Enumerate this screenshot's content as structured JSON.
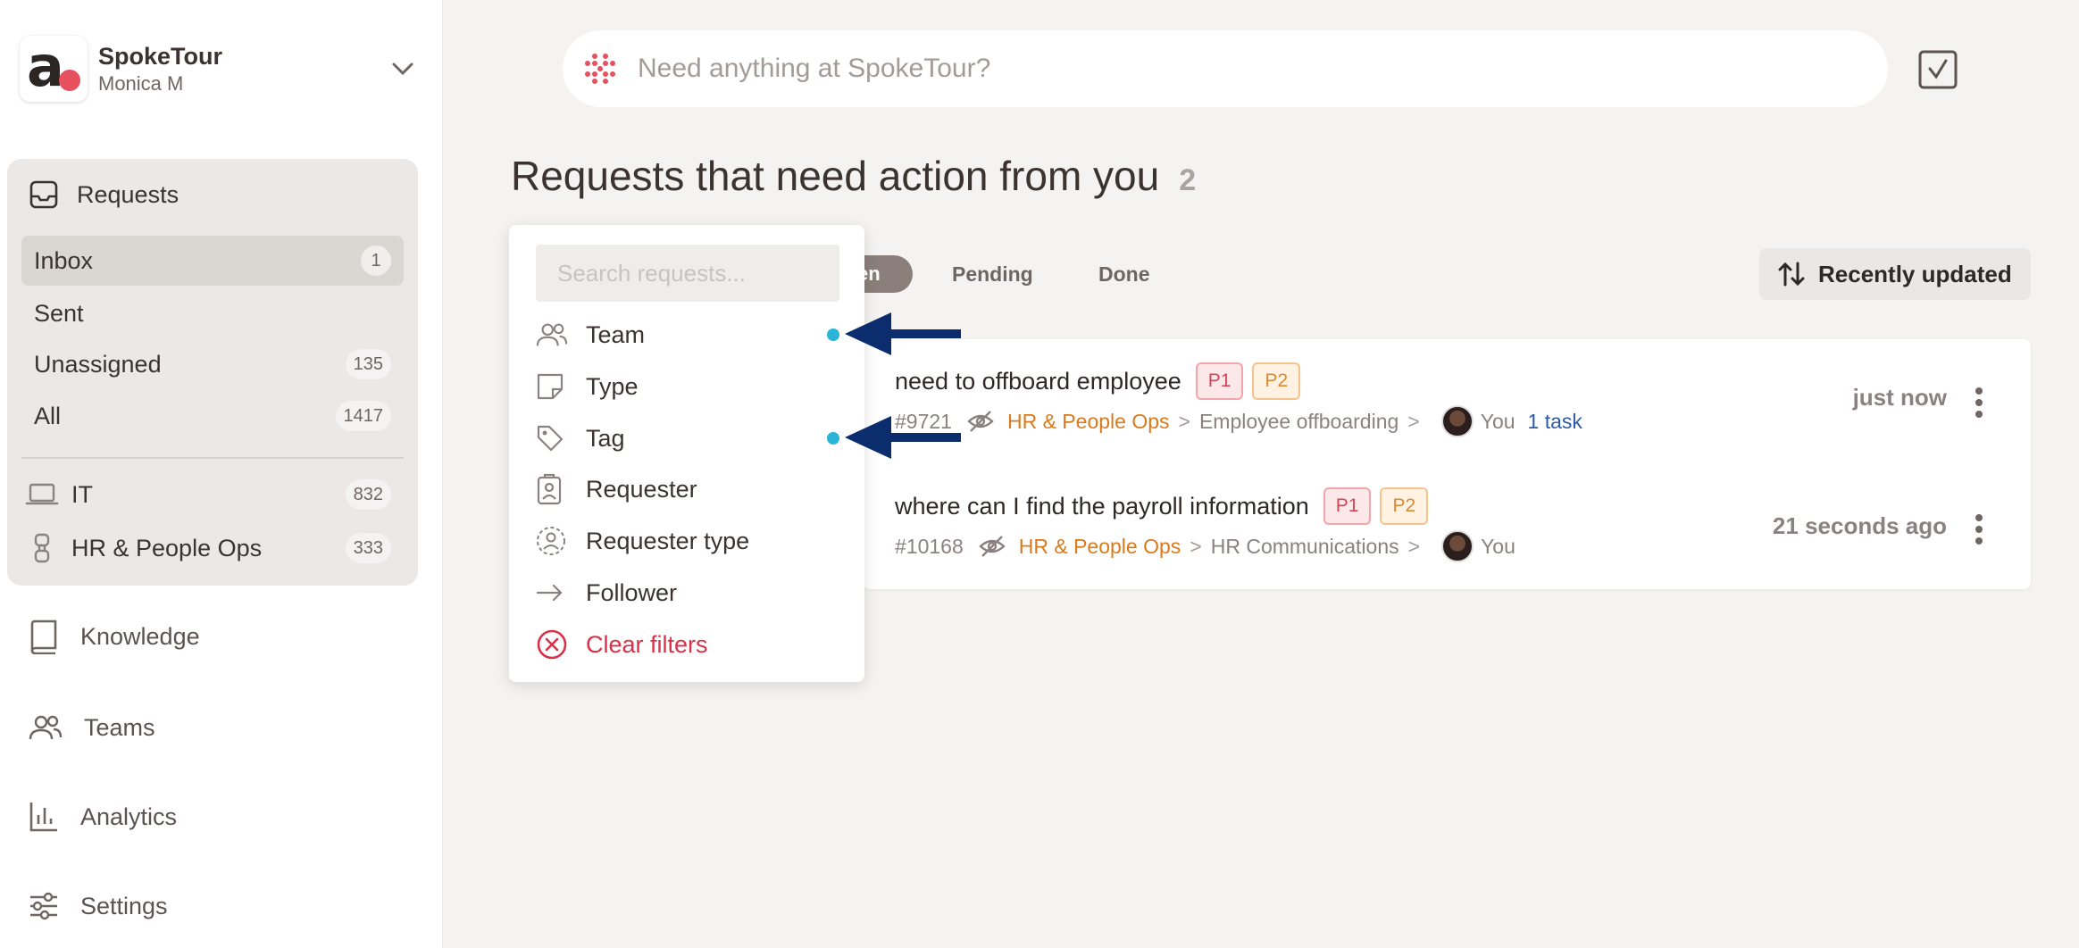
{
  "workspace": {
    "name": "SpokeTour",
    "user": "Monica M",
    "logo_letter": "a"
  },
  "sidebar": {
    "requests_label": "Requests",
    "request_views": [
      {
        "label": "Inbox",
        "count": "1",
        "active": true
      },
      {
        "label": "Sent",
        "count": ""
      },
      {
        "label": "Unassigned",
        "count": "135"
      },
      {
        "label": "All",
        "count": "1417"
      }
    ],
    "teams": [
      {
        "label": "IT",
        "count": "832",
        "icon": "laptop-icon"
      },
      {
        "label": "HR & People Ops",
        "count": "333",
        "icon": "hourglass-icon"
      }
    ],
    "main_nav": [
      {
        "label": "Knowledge",
        "icon": "book-icon"
      },
      {
        "label": "Teams",
        "icon": "people-icon"
      },
      {
        "label": "Analytics",
        "icon": "chart-icon"
      },
      {
        "label": "Settings",
        "icon": "sliders-icon"
      }
    ]
  },
  "topbar": {
    "search_placeholder": "Need anything at SpokeTour?"
  },
  "page": {
    "title": "Requests that need action from you",
    "count": "2"
  },
  "tabs": {
    "active_partial": "en",
    "pending": "Pending",
    "done": "Done"
  },
  "sort": {
    "label": "Recently updated"
  },
  "filter_menu": {
    "search_placeholder": "Search requests...",
    "items": [
      {
        "label": "Team",
        "icon": "people-icon",
        "active_dot": true
      },
      {
        "label": "Type",
        "icon": "note-icon",
        "active_dot": false
      },
      {
        "label": "Tag",
        "icon": "tag-icon",
        "active_dot": true
      },
      {
        "label": "Requester",
        "icon": "badge-icon",
        "active_dot": false
      },
      {
        "label": "Requester type",
        "icon": "dashed-user-icon",
        "active_dot": false
      },
      {
        "label": "Follower",
        "icon": "arrow-right-icon",
        "active_dot": false
      }
    ],
    "clear_label": "Clear filters"
  },
  "requests": [
    {
      "title": "need to offboard employee",
      "badges": [
        "P1",
        "P2"
      ],
      "id": "#9721",
      "team": "HR & People Ops",
      "category": "Employee offboarding",
      "assignee": "You",
      "task": "1 task",
      "time": "just now"
    },
    {
      "title": "where can I find the payroll information",
      "badges": [
        "P1",
        "P2"
      ],
      "id": "#10168",
      "team": "HR & People Ops",
      "category": "HR Communications",
      "assignee": "You",
      "task": "",
      "time": "21 seconds ago"
    }
  ],
  "colors": {
    "accent_red": "#e6505f",
    "dot_cyan": "#2ab4d6",
    "arrow_navy": "#0b2d6e",
    "team_orange": "#d97b1c"
  }
}
